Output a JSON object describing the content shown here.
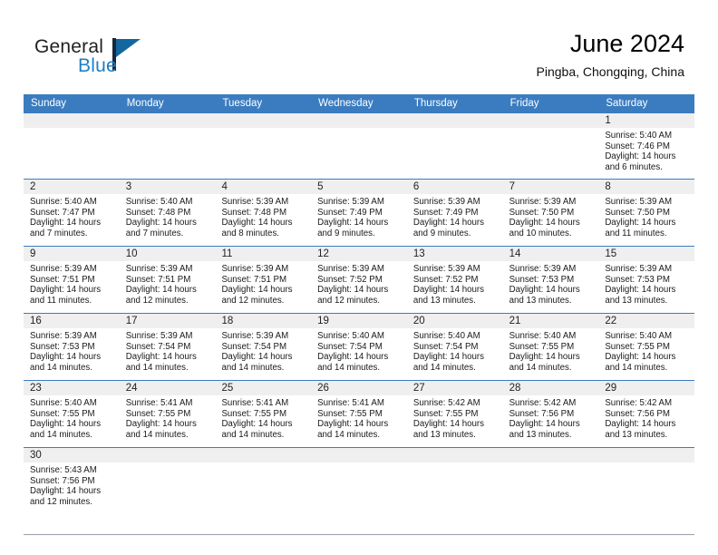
{
  "brand": {
    "name_top": "General",
    "name_bottom": "Blue",
    "accent_color": "#1f7fc4",
    "triangle_color": "#14679e"
  },
  "header": {
    "title": "June 2024",
    "subtitle": "Pingba, Chongqing, China"
  },
  "theme": {
    "header_blue": "#3b7cc0",
    "daynum_band": "#efefef",
    "text": "#1a1a1a"
  },
  "calendar": {
    "weekdays": [
      "Sunday",
      "Monday",
      "Tuesday",
      "Wednesday",
      "Thursday",
      "Friday",
      "Saturday"
    ],
    "weeks": [
      [
        {
          "day": "",
          "empty": true
        },
        {
          "day": "",
          "empty": true
        },
        {
          "day": "",
          "empty": true
        },
        {
          "day": "",
          "empty": true
        },
        {
          "day": "",
          "empty": true
        },
        {
          "day": "",
          "empty": true
        },
        {
          "day": "1",
          "sunrise": "Sunrise: 5:40 AM",
          "sunset": "Sunset: 7:46 PM",
          "daylight_1": "Daylight: 14 hours",
          "daylight_2": "and 6 minutes."
        }
      ],
      [
        {
          "day": "2",
          "sunrise": "Sunrise: 5:40 AM",
          "sunset": "Sunset: 7:47 PM",
          "daylight_1": "Daylight: 14 hours",
          "daylight_2": "and 7 minutes."
        },
        {
          "day": "3",
          "sunrise": "Sunrise: 5:40 AM",
          "sunset": "Sunset: 7:48 PM",
          "daylight_1": "Daylight: 14 hours",
          "daylight_2": "and 7 minutes."
        },
        {
          "day": "4",
          "sunrise": "Sunrise: 5:39 AM",
          "sunset": "Sunset: 7:48 PM",
          "daylight_1": "Daylight: 14 hours",
          "daylight_2": "and 8 minutes."
        },
        {
          "day": "5",
          "sunrise": "Sunrise: 5:39 AM",
          "sunset": "Sunset: 7:49 PM",
          "daylight_1": "Daylight: 14 hours",
          "daylight_2": "and 9 minutes."
        },
        {
          "day": "6",
          "sunrise": "Sunrise: 5:39 AM",
          "sunset": "Sunset: 7:49 PM",
          "daylight_1": "Daylight: 14 hours",
          "daylight_2": "and 9 minutes."
        },
        {
          "day": "7",
          "sunrise": "Sunrise: 5:39 AM",
          "sunset": "Sunset: 7:50 PM",
          "daylight_1": "Daylight: 14 hours",
          "daylight_2": "and 10 minutes."
        },
        {
          "day": "8",
          "sunrise": "Sunrise: 5:39 AM",
          "sunset": "Sunset: 7:50 PM",
          "daylight_1": "Daylight: 14 hours",
          "daylight_2": "and 11 minutes."
        }
      ],
      [
        {
          "day": "9",
          "sunrise": "Sunrise: 5:39 AM",
          "sunset": "Sunset: 7:51 PM",
          "daylight_1": "Daylight: 14 hours",
          "daylight_2": "and 11 minutes."
        },
        {
          "day": "10",
          "sunrise": "Sunrise: 5:39 AM",
          "sunset": "Sunset: 7:51 PM",
          "daylight_1": "Daylight: 14 hours",
          "daylight_2": "and 12 minutes."
        },
        {
          "day": "11",
          "sunrise": "Sunrise: 5:39 AM",
          "sunset": "Sunset: 7:51 PM",
          "daylight_1": "Daylight: 14 hours",
          "daylight_2": "and 12 minutes."
        },
        {
          "day": "12",
          "sunrise": "Sunrise: 5:39 AM",
          "sunset": "Sunset: 7:52 PM",
          "daylight_1": "Daylight: 14 hours",
          "daylight_2": "and 12 minutes."
        },
        {
          "day": "13",
          "sunrise": "Sunrise: 5:39 AM",
          "sunset": "Sunset: 7:52 PM",
          "daylight_1": "Daylight: 14 hours",
          "daylight_2": "and 13 minutes."
        },
        {
          "day": "14",
          "sunrise": "Sunrise: 5:39 AM",
          "sunset": "Sunset: 7:53 PM",
          "daylight_1": "Daylight: 14 hours",
          "daylight_2": "and 13 minutes."
        },
        {
          "day": "15",
          "sunrise": "Sunrise: 5:39 AM",
          "sunset": "Sunset: 7:53 PM",
          "daylight_1": "Daylight: 14 hours",
          "daylight_2": "and 13 minutes."
        }
      ],
      [
        {
          "day": "16",
          "sunrise": "Sunrise: 5:39 AM",
          "sunset": "Sunset: 7:53 PM",
          "daylight_1": "Daylight: 14 hours",
          "daylight_2": "and 14 minutes."
        },
        {
          "day": "17",
          "sunrise": "Sunrise: 5:39 AM",
          "sunset": "Sunset: 7:54 PM",
          "daylight_1": "Daylight: 14 hours",
          "daylight_2": "and 14 minutes."
        },
        {
          "day": "18",
          "sunrise": "Sunrise: 5:39 AM",
          "sunset": "Sunset: 7:54 PM",
          "daylight_1": "Daylight: 14 hours",
          "daylight_2": "and 14 minutes."
        },
        {
          "day": "19",
          "sunrise": "Sunrise: 5:40 AM",
          "sunset": "Sunset: 7:54 PM",
          "daylight_1": "Daylight: 14 hours",
          "daylight_2": "and 14 minutes."
        },
        {
          "day": "20",
          "sunrise": "Sunrise: 5:40 AM",
          "sunset": "Sunset: 7:54 PM",
          "daylight_1": "Daylight: 14 hours",
          "daylight_2": "and 14 minutes."
        },
        {
          "day": "21",
          "sunrise": "Sunrise: 5:40 AM",
          "sunset": "Sunset: 7:55 PM",
          "daylight_1": "Daylight: 14 hours",
          "daylight_2": "and 14 minutes."
        },
        {
          "day": "22",
          "sunrise": "Sunrise: 5:40 AM",
          "sunset": "Sunset: 7:55 PM",
          "daylight_1": "Daylight: 14 hours",
          "daylight_2": "and 14 minutes."
        }
      ],
      [
        {
          "day": "23",
          "sunrise": "Sunrise: 5:40 AM",
          "sunset": "Sunset: 7:55 PM",
          "daylight_1": "Daylight: 14 hours",
          "daylight_2": "and 14 minutes."
        },
        {
          "day": "24",
          "sunrise": "Sunrise: 5:41 AM",
          "sunset": "Sunset: 7:55 PM",
          "daylight_1": "Daylight: 14 hours",
          "daylight_2": "and 14 minutes."
        },
        {
          "day": "25",
          "sunrise": "Sunrise: 5:41 AM",
          "sunset": "Sunset: 7:55 PM",
          "daylight_1": "Daylight: 14 hours",
          "daylight_2": "and 14 minutes."
        },
        {
          "day": "26",
          "sunrise": "Sunrise: 5:41 AM",
          "sunset": "Sunset: 7:55 PM",
          "daylight_1": "Daylight: 14 hours",
          "daylight_2": "and 14 minutes."
        },
        {
          "day": "27",
          "sunrise": "Sunrise: 5:42 AM",
          "sunset": "Sunset: 7:55 PM",
          "daylight_1": "Daylight: 14 hours",
          "daylight_2": "and 13 minutes."
        },
        {
          "day": "28",
          "sunrise": "Sunrise: 5:42 AM",
          "sunset": "Sunset: 7:56 PM",
          "daylight_1": "Daylight: 14 hours",
          "daylight_2": "and 13 minutes."
        },
        {
          "day": "29",
          "sunrise": "Sunrise: 5:42 AM",
          "sunset": "Sunset: 7:56 PM",
          "daylight_1": "Daylight: 14 hours",
          "daylight_2": "and 13 minutes."
        }
      ],
      [
        {
          "day": "30",
          "sunrise": "Sunrise: 5:43 AM",
          "sunset": "Sunset: 7:56 PM",
          "daylight_1": "Daylight: 14 hours",
          "daylight_2": "and 12 minutes."
        },
        {
          "day": "",
          "empty": true
        },
        {
          "day": "",
          "empty": true
        },
        {
          "day": "",
          "empty": true
        },
        {
          "day": "",
          "empty": true
        },
        {
          "day": "",
          "empty": true
        },
        {
          "day": "",
          "empty": true
        }
      ]
    ]
  }
}
